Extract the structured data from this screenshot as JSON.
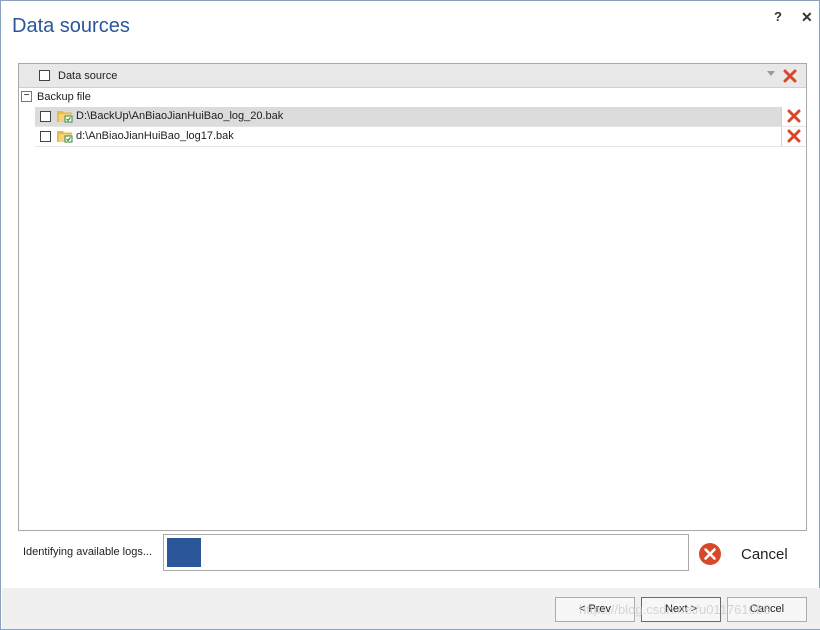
{
  "window": {
    "title": "Data sources",
    "help_label": "?",
    "close_label": "✕"
  },
  "grid": {
    "column_header": "Data source",
    "group": {
      "expander": "−",
      "label": "Backup file"
    },
    "rows": [
      {
        "label": "D:\\BackUp\\AnBiaoJianHuiBao_log_20.bak",
        "selected": true
      },
      {
        "label": "d:\\AnBiaoJianHuiBao_log17.bak",
        "selected": false
      }
    ]
  },
  "status": {
    "text": "Identifying available logs...",
    "progress_fraction": 0.065,
    "cancel_label": "Cancel"
  },
  "footer": {
    "prev_label": "< Prev",
    "next_label": "Next >",
    "cancel_label": "Cancel",
    "watermark": "https://blog.csdn.net/u011761086"
  },
  "colors": {
    "accent": "#2b579a",
    "delete": "#d9472b"
  }
}
